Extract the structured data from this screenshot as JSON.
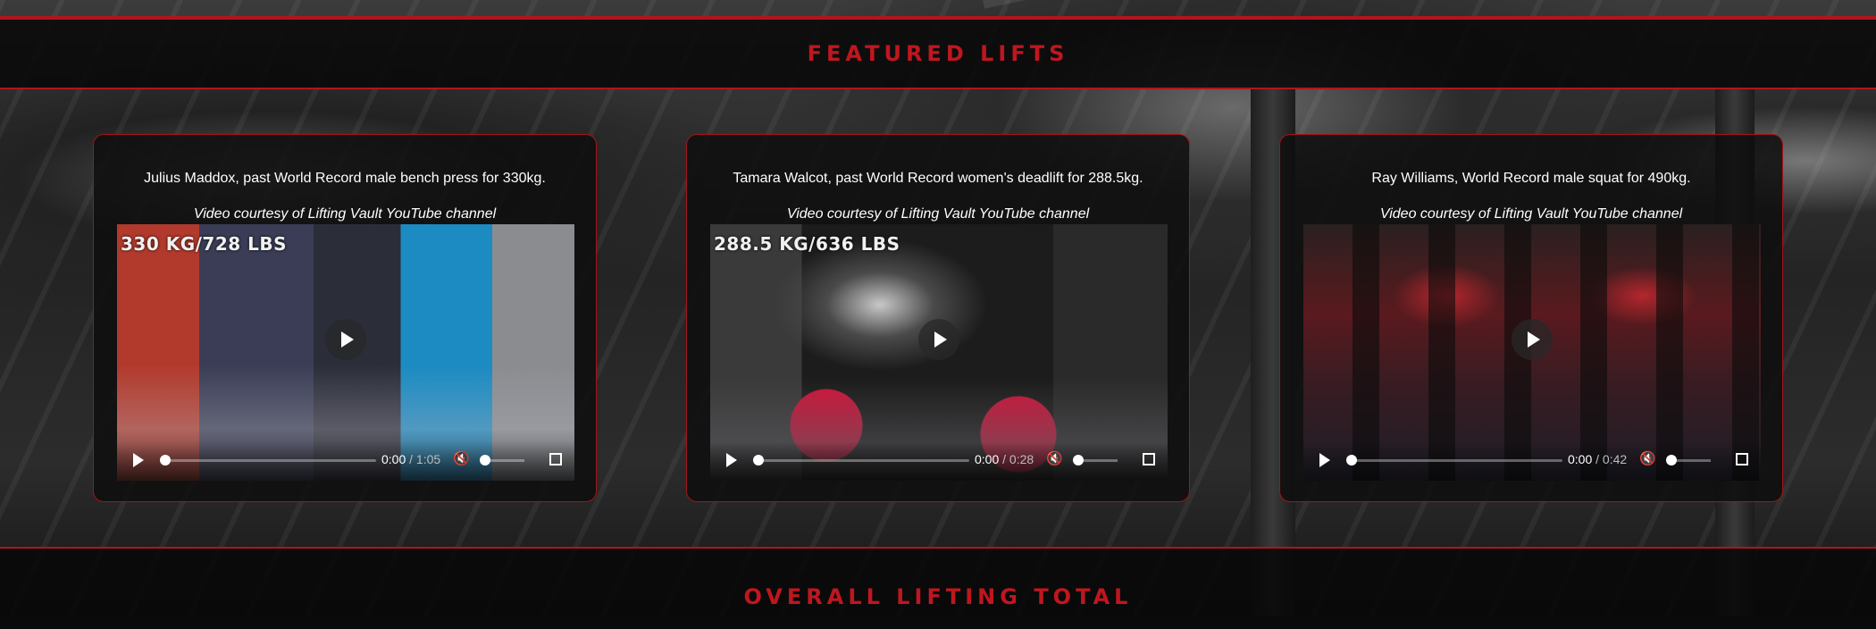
{
  "sections": {
    "featured_title": "FEATURED LIFTS",
    "total_title": "OVERALL LIFTING TOTAL"
  },
  "colors": {
    "accent": "#c0161f",
    "border": "#b3141b",
    "card_bg": "#0e0e0e",
    "text": "#ffffff"
  },
  "cards": [
    {
      "caption": "Julius Maddox, past World Record male bench press for 330kg.",
      "credit": "Video courtesy of Lifting Vault YouTube channel",
      "overlay": "330 KG/728 LBS",
      "time_current": "0:00",
      "time_separator": " / ",
      "time_duration": "1:05"
    },
    {
      "caption": "Tamara Walcot, past World Record women's deadlift for 288.5kg.",
      "credit": "Video courtesy of Lifting Vault YouTube channel",
      "overlay": "288.5 KG/636 LBS",
      "time_current": "0:00",
      "time_separator": " / ",
      "time_duration": "0:28"
    },
    {
      "caption": "Ray Williams, World Record male squat for 490kg.",
      "credit": "Video courtesy of Lifting Vault YouTube channel",
      "overlay": "",
      "time_current": "0:00",
      "time_separator": " / ",
      "time_duration": "0:42"
    }
  ],
  "icons": {
    "play": "play-icon",
    "mute": "muted-speaker-icon",
    "fullscreen": "fullscreen-icon"
  }
}
